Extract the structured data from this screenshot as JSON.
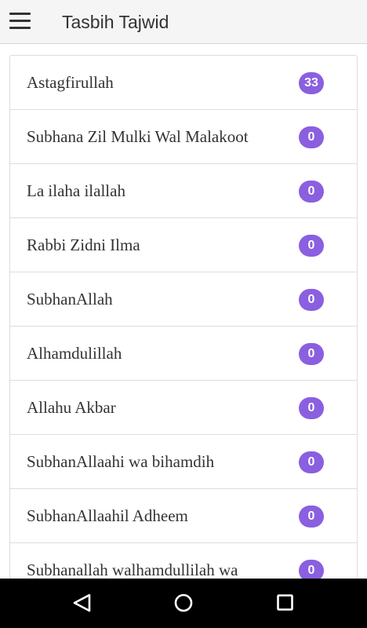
{
  "app": {
    "title": "Tasbih Tajwid",
    "menu_icon": "hamburger-menu-icon"
  },
  "tasbih_list": [
    {
      "label": "Astagfirullah",
      "count": "33"
    },
    {
      "label": "Subhana Zil Mulki Wal Malakoot",
      "count": "0"
    },
    {
      "label": "La ilaha ilallah",
      "count": "0"
    },
    {
      "label": "Rabbi Zidni Ilma",
      "count": "0"
    },
    {
      "label": "SubhanAllah",
      "count": "0"
    },
    {
      "label": "Alhamdulillah",
      "count": "0"
    },
    {
      "label": "Allahu Akbar",
      "count": "0"
    },
    {
      "label": "SubhanAllaahi wa bihamdih",
      "count": "0"
    },
    {
      "label": "SubhanAllaahil Adheem",
      "count": "0"
    },
    {
      "label": "Subhanallah walhamdullilah wa",
      "count": "0"
    }
  ],
  "navbar": {
    "back_icon": "back-triangle-icon",
    "home_icon": "home-circle-icon",
    "recents_icon": "recents-square-icon"
  },
  "colors": {
    "badge": "#8a5fe0",
    "appbar_background": "#f5f5f5",
    "navbar_background": "#000000",
    "text": "#333333"
  }
}
